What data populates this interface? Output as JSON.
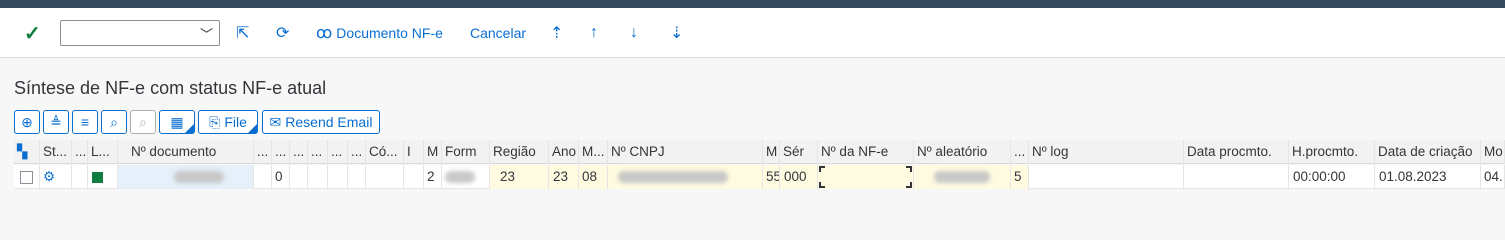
{
  "toolbar": {
    "doc_btn": "Documento NF-e",
    "cancel_btn": "Cancelar",
    "combo_value": ""
  },
  "title": "Síntese de NF-e com status NF-e atual",
  "grid_toolbar": {
    "file": "File",
    "resend": "Resend Email"
  },
  "columns": [
    "St...",
    "...",
    "L...",
    "Nº documento",
    "...",
    "...",
    "...",
    "...",
    "...",
    "...",
    "Có...",
    "I",
    "M",
    "Form",
    "Região",
    "Ano",
    "M...",
    "Nº CNPJ",
    "M",
    "Sér",
    "Nº da NF-e",
    "Nº aleatório",
    "...",
    "Nº log",
    "Data procmto.",
    "H.procmto.",
    "Data de criação",
    "Mo"
  ],
  "row": {
    "col_blank_1": "0",
    "m": "2",
    "regiao": "23",
    "ano": "23",
    "mes": "08",
    "model": "55",
    "serie": "000",
    "status_num": "5",
    "hora": "00:00:00",
    "data_criacao": "01.08.2023",
    "mo": "04."
  },
  "colors": {
    "accent": "#0a6ed1",
    "header_bar": "#354a5f",
    "ok_green": "#107e3e"
  }
}
